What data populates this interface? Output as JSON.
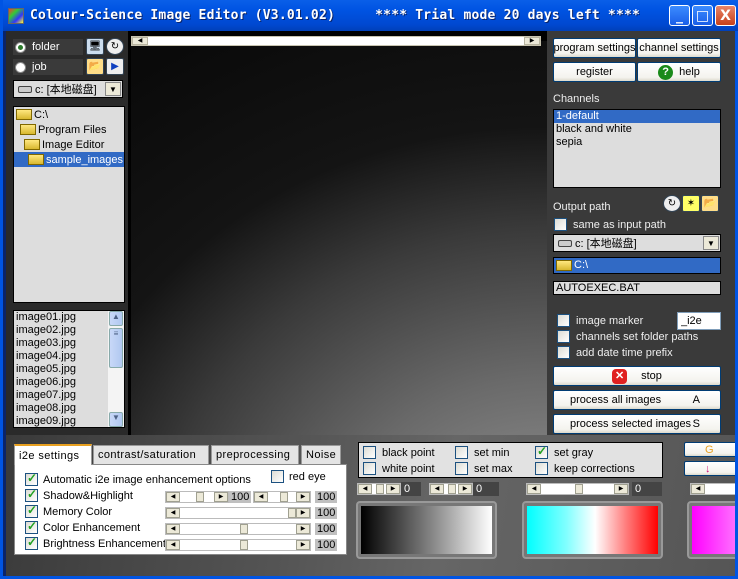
{
  "window": {
    "title": "Colour-Science Image Editor (V3.01.02)     **** Trial mode 20 days left ****",
    "minimize_label": "_",
    "maximize_label": "□",
    "close_label": "X"
  },
  "left": {
    "mode_options": [
      {
        "label": "folder",
        "selected": true
      },
      {
        "label": "job",
        "selected": false
      }
    ],
    "drive_combo": "c: [本地磁盘]",
    "tree": [
      {
        "label": "C:\\",
        "indent": 0,
        "selected": false
      },
      {
        "label": "Program Files",
        "indent": 1,
        "selected": false
      },
      {
        "label": "Image Editor",
        "indent": 2,
        "selected": false
      },
      {
        "label": "sample_images",
        "indent": 3,
        "selected": true
      }
    ],
    "files": [
      "image01.jpg",
      "image02.jpg",
      "image03.jpg",
      "image04.jpg",
      "image05.jpg",
      "image06.jpg",
      "image07.jpg",
      "image08.jpg",
      "image09.jpg"
    ]
  },
  "right": {
    "program_settings": "program settings",
    "channel_settings": "channel settings",
    "register": "register",
    "help": "help",
    "channels_label": "Channels",
    "channels": [
      {
        "label": "1-default",
        "selected": true
      },
      {
        "label": "black and white",
        "selected": false
      },
      {
        "label": "sepia",
        "selected": false
      }
    ],
    "output_path_label": "Output path",
    "same_as_input": "same as input path",
    "output_drive": "c: [本地磁盘]",
    "output_folder": "C:\\",
    "output_file": "AUTOEXEC.BAT",
    "image_marker": "image marker",
    "image_marker_value": "_i2e",
    "channels_set_folder": "channels set folder paths",
    "add_date_prefix": "add date time prefix",
    "stop": "stop",
    "process_all": "process all images",
    "process_all_key": "A",
    "process_selected": "process selected images",
    "process_selected_key": "S"
  },
  "tabs": [
    {
      "label": "i2e settings",
      "active": true
    },
    {
      "label": "contrast/saturation",
      "active": false
    },
    {
      "label": "preprocessing",
      "active": false
    },
    {
      "label": "Noise",
      "active": false
    }
  ],
  "i2e": {
    "auto_label": "Automatic i2e image enhancement options",
    "auto_checked": true,
    "red_eye": "red eye",
    "red_eye_checked": false,
    "rows": [
      {
        "label": "Shadow&Highlight",
        "checked": true,
        "value": "100",
        "value2": "100"
      },
      {
        "label": "Memory Color",
        "checked": true,
        "value": "100"
      },
      {
        "label": "Color Enhancement",
        "checked": true,
        "value": "100"
      },
      {
        "label": "Brightness Enhancement",
        "checked": true,
        "value": "100"
      }
    ]
  },
  "points": {
    "black_point": "black point",
    "white_point": "white point",
    "set_min": "set min",
    "set_max": "set max",
    "set_gray": "set gray",
    "set_gray_checked": true,
    "keep_corrections": "keep corrections",
    "slider1_value": "0",
    "slider2_value": "0",
    "slider3_value": "0"
  },
  "colors": {
    "selection": "#316ac5",
    "titlebar": "#0054e3",
    "check": "#21a121"
  }
}
